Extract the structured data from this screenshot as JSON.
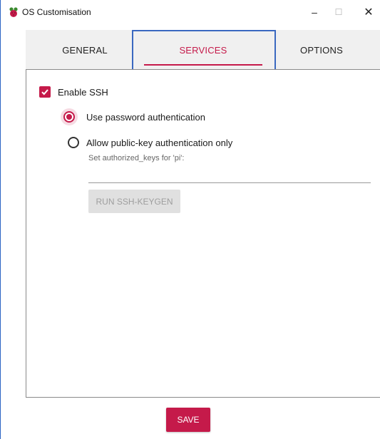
{
  "window": {
    "title": "OS Customisation"
  },
  "titlebar_buttons": {
    "minimize": "–",
    "maximize": "☐",
    "close": "✕"
  },
  "tabs": [
    {
      "label": "GENERAL",
      "selected": false
    },
    {
      "label": "SERVICES",
      "selected": true
    },
    {
      "label": "OPTIONS",
      "selected": false
    }
  ],
  "services": {
    "enable_ssh": {
      "label": "Enable SSH",
      "checked": true
    },
    "auth_options": [
      {
        "label": "Use password authentication",
        "selected": true
      },
      {
        "label": "Allow public-key authentication only",
        "selected": false
      }
    ],
    "authorized_keys_label": "Set authorized_keys for 'pi':",
    "authorized_keys_value": "",
    "keygen_button": "RUN SSH-KEYGEN"
  },
  "save_button": "SAVE",
  "colors": {
    "accent": "#c51a4a",
    "focus_outline": "#3a68c0",
    "tab_bg": "#f0f0f0"
  }
}
